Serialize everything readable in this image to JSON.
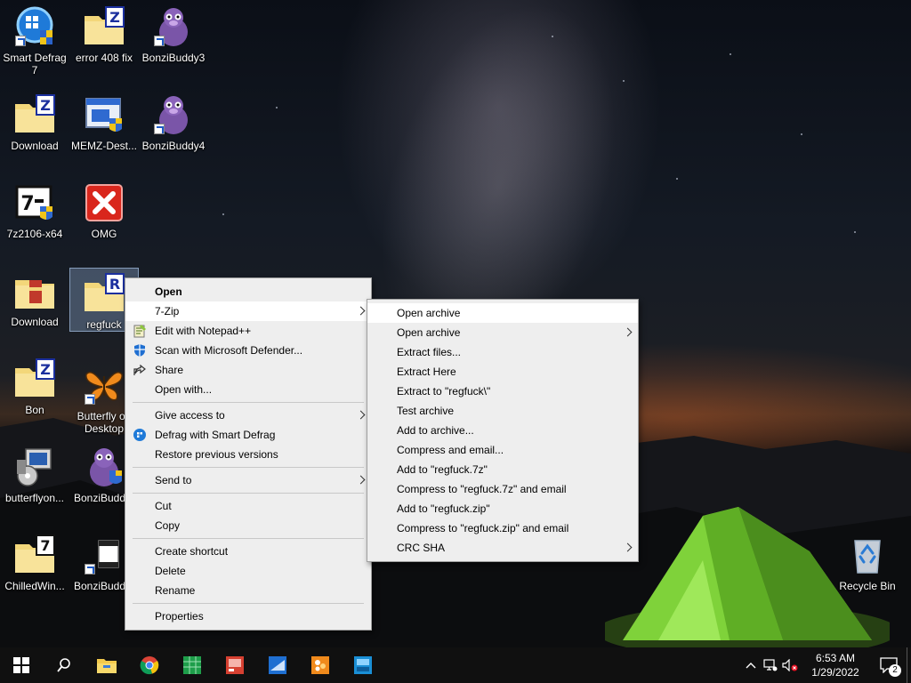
{
  "desktop": {
    "icons": [
      {
        "label": "Smart Defrag 7",
        "icon": "smart-defrag-icon"
      },
      {
        "label": "error 408 fix",
        "icon": "winzip-folder-icon"
      },
      {
        "label": "BonziBuddy3",
        "icon": "bonzibuddy-icon"
      },
      {
        "label": "Download",
        "icon": "winzip-folder-icon"
      },
      {
        "label": "MEMZ-Dest...",
        "icon": "installer-icon"
      },
      {
        "label": "BonziBuddy4",
        "icon": "bonzibuddy-icon"
      },
      {
        "label": "7z2106-x64",
        "icon": "seven-zip-installer-icon"
      },
      {
        "label": "OMG",
        "icon": "error-x-icon"
      },
      {
        "label": "Download",
        "icon": "winrar-folder-icon"
      },
      {
        "label": "regfuck",
        "icon": "winrar-archive-icon"
      },
      {
        "label": "Bon",
        "icon": "winzip-folder-icon"
      },
      {
        "label": "Butterfly on Desktop",
        "icon": "butterfly-icon"
      },
      {
        "label": "butterflyon...",
        "icon": "setup-icon"
      },
      {
        "label": "BonziBudd...",
        "icon": "bonzibuddy-icon"
      },
      {
        "label": "ChilledWin...",
        "icon": "seven-zip-folder-icon"
      },
      {
        "label": "BonziBudd...",
        "icon": "video-file-icon"
      },
      {
        "label": "Recycle Bin",
        "icon": "recycle-bin-icon"
      }
    ]
  },
  "context_menu": {
    "items": {
      "open": "Open",
      "seven_zip": "7-Zip",
      "edit_notepad": "Edit with Notepad++",
      "scan_defender": "Scan with Microsoft Defender...",
      "share": "Share",
      "open_with": "Open with...",
      "give_access": "Give access to",
      "defrag": "Defrag with Smart Defrag",
      "restore": "Restore previous versions",
      "send_to": "Send to",
      "cut": "Cut",
      "copy": "Copy",
      "create_shortcut": "Create shortcut",
      "delete": "Delete",
      "rename": "Rename",
      "properties": "Properties"
    }
  },
  "submenu_7zip": {
    "items": [
      {
        "label": "Open archive",
        "arrow": false
      },
      {
        "label": "Open archive",
        "arrow": true
      },
      {
        "label": "Extract files...",
        "arrow": false
      },
      {
        "label": "Extract Here",
        "arrow": false
      },
      {
        "label": "Extract to \"regfuck\\\"",
        "arrow": false
      },
      {
        "label": "Test archive",
        "arrow": false
      },
      {
        "label": "Add to archive...",
        "arrow": false
      },
      {
        "label": "Compress and email...",
        "arrow": false
      },
      {
        "label": "Add to \"regfuck.7z\"",
        "arrow": false
      },
      {
        "label": "Compress to \"regfuck.7z\" and email",
        "arrow": false
      },
      {
        "label": "Add to \"regfuck.zip\"",
        "arrow": false
      },
      {
        "label": "Compress to \"regfuck.zip\" and email",
        "arrow": false
      },
      {
        "label": "CRC SHA",
        "arrow": true
      }
    ]
  },
  "taskbar": {
    "time": "6:53 AM",
    "date": "1/29/2022",
    "notification_count": "2",
    "pinned": [
      "windows-start-icon",
      "search-icon",
      "file-explorer-icon",
      "chrome-icon",
      "spreadsheet-app-icon",
      "presentation-app-icon",
      "mail-app-icon",
      "colorful-app-icon",
      "blue-app-icon"
    ]
  }
}
